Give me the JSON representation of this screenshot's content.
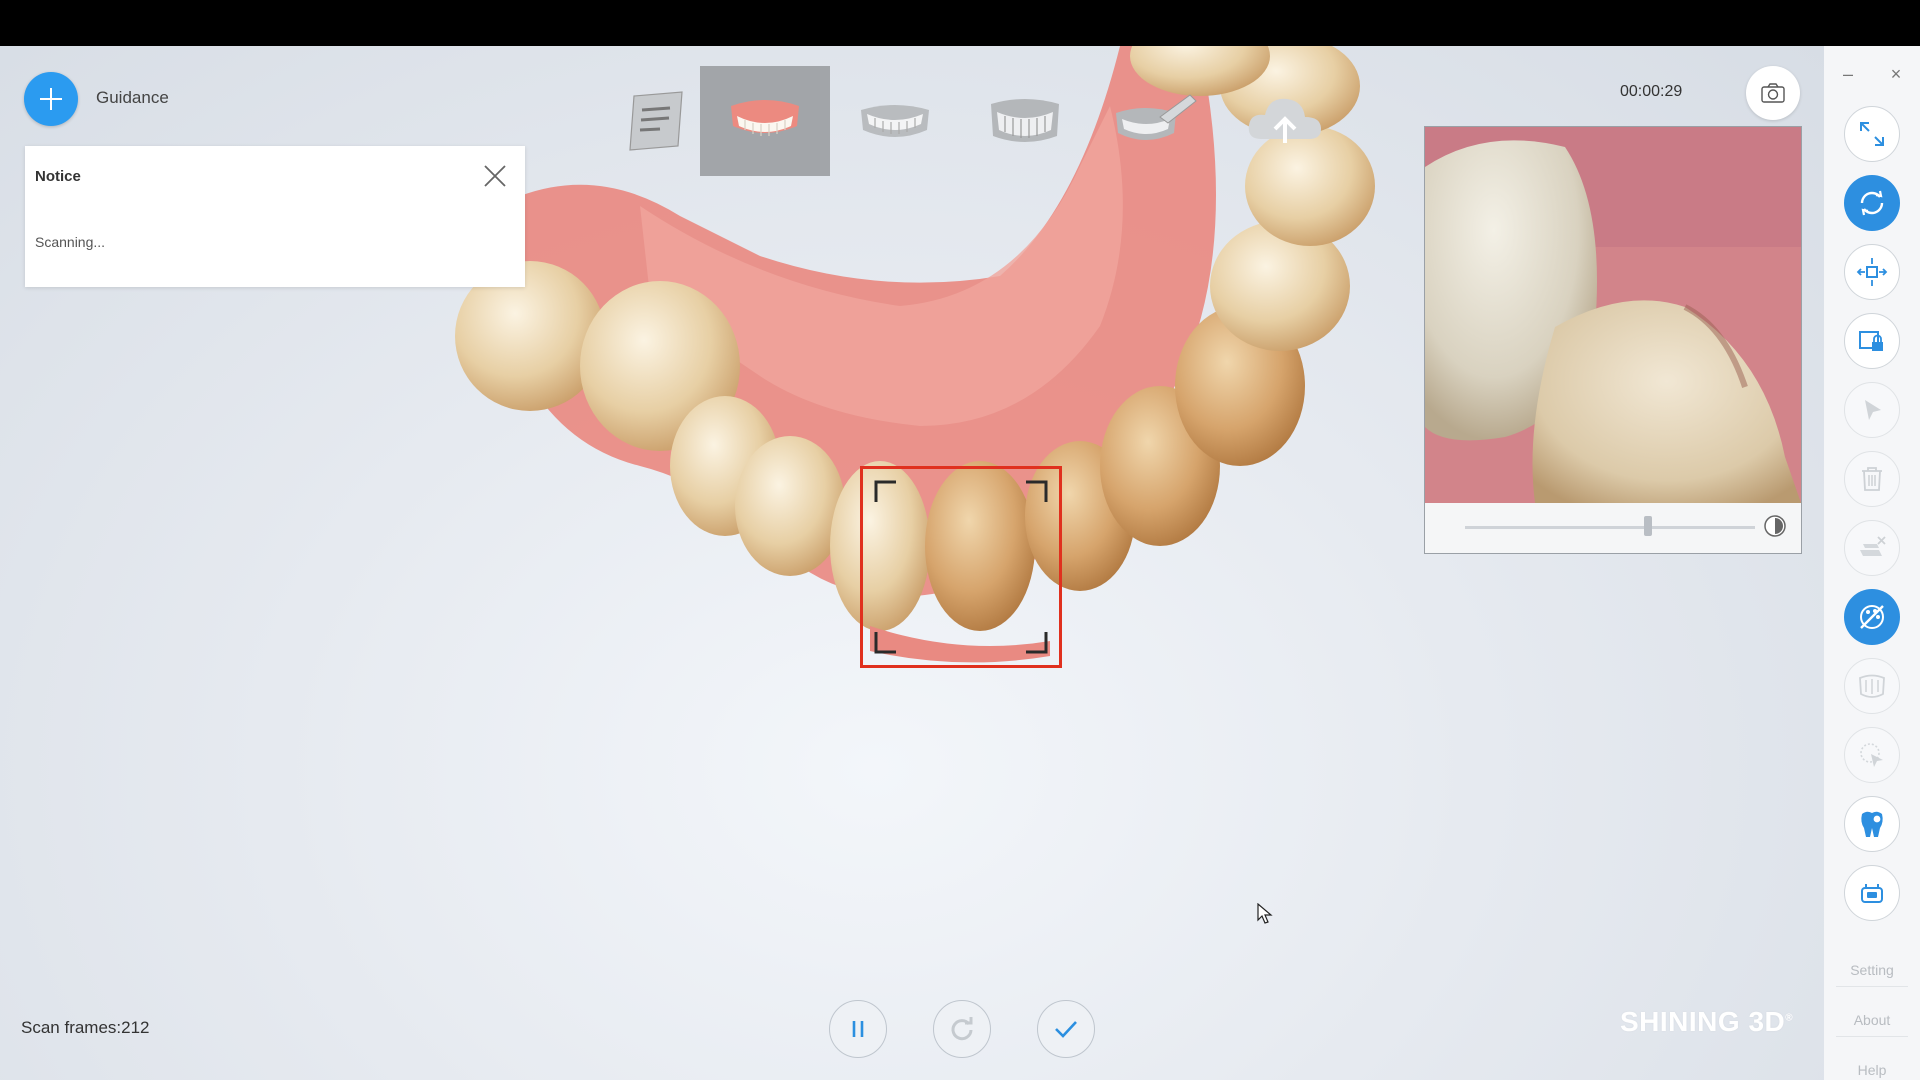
{
  "header": {
    "guidance_label": "Guidance",
    "timer": "00:00:29"
  },
  "notice": {
    "title": "Notice",
    "message": "Scanning..."
  },
  "steps": [
    {
      "name": "notes",
      "active": false
    },
    {
      "name": "upper-jaw",
      "active": true
    },
    {
      "name": "lower-jaw",
      "active": false
    },
    {
      "name": "bite",
      "active": false
    },
    {
      "name": "edit-scan",
      "active": false
    },
    {
      "name": "upload",
      "active": false
    }
  ],
  "status": {
    "scan_frames": "Scan frames:212"
  },
  "brand": {
    "name": "SHINING 3D",
    "mark": "®"
  },
  "sidebar": {
    "links": {
      "setting": "Setting",
      "about": "About",
      "help": "Help"
    },
    "window": {
      "minimize": "–",
      "close": "×"
    }
  },
  "preview": {
    "slider_value": 0.63
  },
  "colors": {
    "accent": "#2b9bf0",
    "tool_active": "#2d8fe0",
    "scan_frame": "#e0301e",
    "gum": "#e98a82"
  }
}
